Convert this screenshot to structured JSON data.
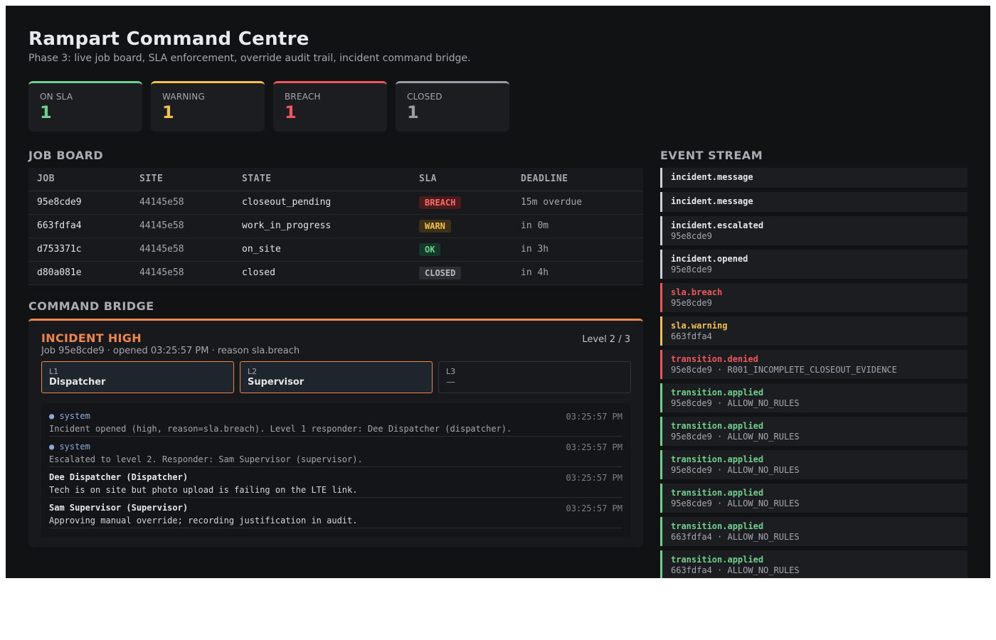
{
  "header": {
    "title": "Rampart Command Centre",
    "subtitle": "Phase 3: live job board, SLA enforcement, override audit trail, incident command bridge."
  },
  "stats": [
    {
      "label": "ON SLA",
      "value": "1",
      "color": "#6fd08c"
    },
    {
      "label": "WARNING",
      "value": "1",
      "color": "#f2c14e"
    },
    {
      "label": "BREACH",
      "value": "1",
      "color": "#f0575a"
    },
    {
      "label": "CLOSED",
      "value": "1",
      "color": "#9a9da3"
    }
  ],
  "job_board": {
    "title": "JOB BOARD",
    "columns": [
      "JOB",
      "SITE",
      "STATE",
      "SLA",
      "DEADLINE"
    ],
    "rows": [
      {
        "job": "95e8cde9",
        "site": "44145e58",
        "state": "closeout_pending",
        "sla": "BREACH",
        "deadline": "15m overdue"
      },
      {
        "job": "663fdfa4",
        "site": "44145e58",
        "state": "work_in_progress",
        "sla": "WARN",
        "deadline": "in 0m"
      },
      {
        "job": "d753371c",
        "site": "44145e58",
        "state": "on_site",
        "sla": "OK",
        "deadline": "in 3h"
      },
      {
        "job": "d80a081e",
        "site": "44145e58",
        "state": "closed",
        "sla": "CLOSED",
        "deadline": "in 4h"
      }
    ]
  },
  "sla_badge_colors": {
    "BREACH": {
      "fg": "#ff6b6b",
      "bg": "#4a1a1d"
    },
    "WARN": {
      "fg": "#f2c14e",
      "bg": "#3d3217"
    },
    "OK": {
      "fg": "#6fd08c",
      "bg": "#15382a"
    },
    "CLOSED": {
      "fg": "#b6b9be",
      "bg": "#2c2e33"
    }
  },
  "command_bridge": {
    "title": "COMMAND BRIDGE",
    "incident_title": "INCIDENT HIGH",
    "incident_meta": "Job 95e8cde9 · opened 03:25:57 PM · reason sla.breach",
    "level": "Level 2 / 3",
    "levels": [
      {
        "code": "L1",
        "who": "Dispatcher",
        "state": "active"
      },
      {
        "code": "L2",
        "who": "Supervisor",
        "state": "active"
      },
      {
        "code": "L3",
        "who": "—",
        "state": "inactive"
      }
    ],
    "messages": [
      {
        "from": "● system",
        "system": true,
        "time": "03:25:57 PM",
        "body": "Incident opened (high, reason=sla.breach). Level 1 responder: Dee Dispatcher (dispatcher)."
      },
      {
        "from": "● system",
        "system": true,
        "time": "03:25:57 PM",
        "body": "Escalated to level 2. Responder: Sam Supervisor (supervisor)."
      },
      {
        "from": "Dee Dispatcher (Dispatcher)",
        "system": false,
        "time": "03:25:57 PM",
        "body": "Tech is on site but photo upload is failing on the LTE link."
      },
      {
        "from": "Sam Supervisor (Supervisor)",
        "system": false,
        "time": "03:25:57 PM",
        "body": "Approving manual override; recording justification in audit."
      }
    ]
  },
  "event_stream": {
    "title": "EVENT STREAM",
    "events": [
      {
        "name": "incident.message",
        "detail": "",
        "color": "#cfd0d4",
        "name_color": "#e8e9ec"
      },
      {
        "name": "incident.message",
        "detail": "",
        "color": "#cfd0d4",
        "name_color": "#e8e9ec"
      },
      {
        "name": "incident.escalated",
        "detail": "95e8cde9",
        "color": "#cfd0d4",
        "name_color": "#e8e9ec"
      },
      {
        "name": "incident.opened",
        "detail": "95e8cde9",
        "color": "#cfd0d4",
        "name_color": "#e8e9ec"
      },
      {
        "name": "sla.breach",
        "detail": "95e8cde9",
        "color": "#f0575a",
        "name_color": "#f0575a"
      },
      {
        "name": "sla.warning",
        "detail": "663fdfa4",
        "color": "#f2c14e",
        "name_color": "#f2c14e"
      },
      {
        "name": "transition.denied",
        "detail": "95e8cde9 · R001_INCOMPLETE_CLOSEOUT_EVIDENCE",
        "color": "#f0575a",
        "name_color": "#f0575a"
      },
      {
        "name": "transition.applied",
        "detail": "95e8cde9 · ALLOW_NO_RULES",
        "color": "#6fd08c",
        "name_color": "#6fd08c"
      },
      {
        "name": "transition.applied",
        "detail": "95e8cde9 · ALLOW_NO_RULES",
        "color": "#6fd08c",
        "name_color": "#6fd08c"
      },
      {
        "name": "transition.applied",
        "detail": "95e8cde9 · ALLOW_NO_RULES",
        "color": "#6fd08c",
        "name_color": "#6fd08c"
      },
      {
        "name": "transition.applied",
        "detail": "95e8cde9 · ALLOW_NO_RULES",
        "color": "#6fd08c",
        "name_color": "#6fd08c"
      },
      {
        "name": "transition.applied",
        "detail": "663fdfa4 · ALLOW_NO_RULES",
        "color": "#6fd08c",
        "name_color": "#6fd08c"
      },
      {
        "name": "transition.applied",
        "detail": "663fdfa4 · ALLOW_NO_RULES",
        "color": "#6fd08c",
        "name_color": "#6fd08c"
      }
    ]
  }
}
